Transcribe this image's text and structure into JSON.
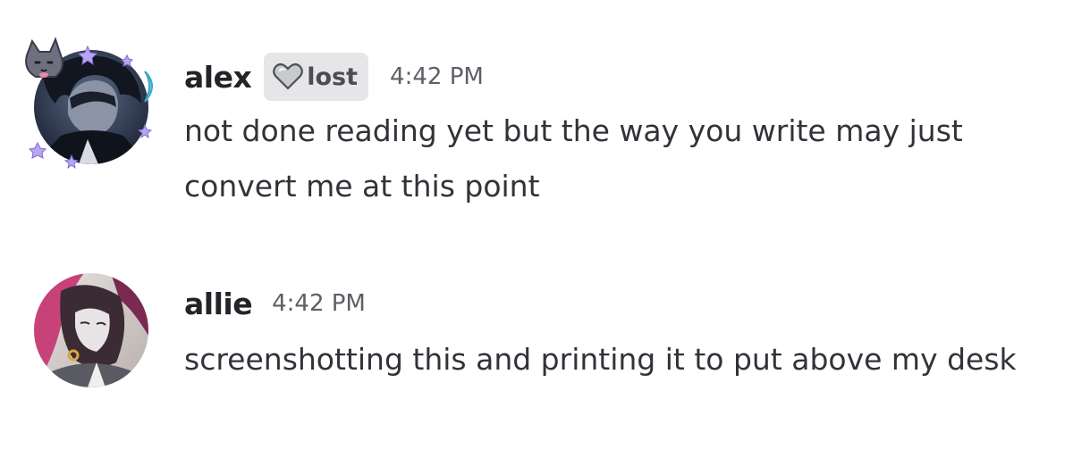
{
  "messages": [
    {
      "username": "alex",
      "tag": {
        "icon": "grey-heart-icon",
        "label": "lost",
        "color": "#e6e6e8"
      },
      "timestamp": "4:42 PM",
      "content": "not done reading yet but the way you write may just convert me at this point",
      "avatar": {
        "icon": "avatar-dark-hair-with-cat-decoration",
        "decoration": "wolf-and-stars-decoration"
      }
    },
    {
      "username": "allie",
      "timestamp": "4:42 PM",
      "content": "screenshotting this and printing it to put above my desk",
      "avatar": {
        "icon": "avatar-pale-character-with-earrings",
        "ring_color": "#c8427a"
      }
    }
  ]
}
